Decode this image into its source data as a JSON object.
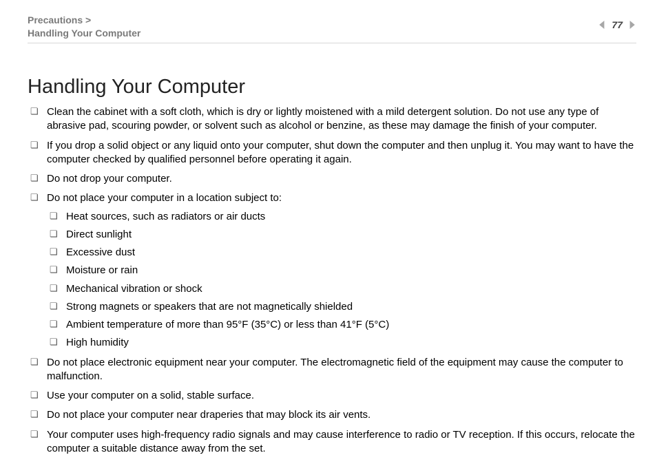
{
  "breadcrumb": {
    "line1": "Precautions >",
    "line2": "Handling Your Computer"
  },
  "page_number": "77",
  "title": "Handling Your Computer",
  "bullets": [
    {
      "text": "Clean the cabinet with a soft cloth, which is dry or lightly moistened with a mild detergent solution. Do not use any type of abrasive pad, scouring powder, or solvent such as alcohol or benzine, as these may damage the finish of your computer."
    },
    {
      "text": "If you drop a solid object or any liquid onto your computer, shut down the computer and then unplug it. You may want to have the computer checked by qualified personnel before operating it again."
    },
    {
      "text": "Do not drop your computer."
    },
    {
      "text": "Do not place your computer in a location subject to:",
      "sub": [
        "Heat sources, such as radiators or air ducts",
        "Direct sunlight",
        "Excessive dust",
        "Moisture or rain",
        "Mechanical vibration or shock",
        "Strong magnets or speakers that are not magnetically shielded",
        "Ambient temperature of more than 95°F (35°C) or less than 41°F (5°C)",
        "High humidity"
      ]
    },
    {
      "text": "Do not place electronic equipment near your computer. The electromagnetic field of the equipment may cause the computer to malfunction."
    },
    {
      "text": "Use your computer on a solid, stable surface."
    },
    {
      "text": "Do not place your computer near draperies that may block its air vents."
    },
    {
      "text": "Your computer uses high-frequency radio signals and may cause interference to radio or TV reception. If this occurs, relocate the computer a suitable distance away from the set."
    }
  ]
}
